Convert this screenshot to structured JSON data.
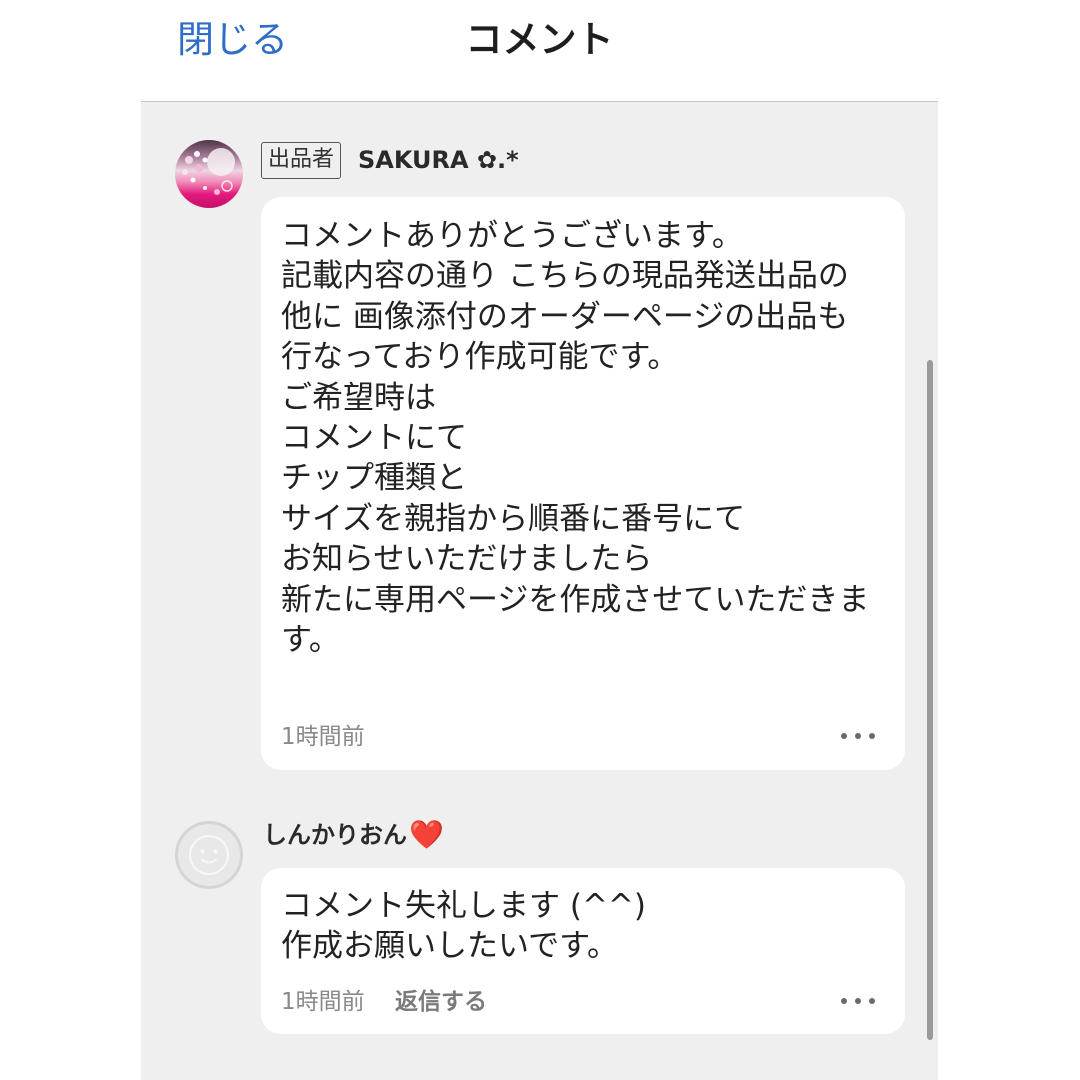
{
  "header": {
    "close_label": "閉じる",
    "title": "コメント"
  },
  "comments": [
    {
      "avatar_icon": "cherry-blossom-avatar-icon",
      "seller_badge": "出品者",
      "author": "SAKURA ✿.*",
      "body_lines": [
        "コメントありがとうございます。",
        "記載内容の通り こちらの現品発送出品の",
        "他に 画像添付のオーダーページの出品も",
        "行なっており作成可能です。",
        "ご希望時は",
        "コメントにて",
        "チップ種類と",
        "サイズを親指から順番に番号にて",
        "お知らせいただけましたら",
        "新たに専用ページを作成させていただきま",
        "す。"
      ],
      "time": "1時間前",
      "more_icon": "more-options-icon"
    },
    {
      "avatar_icon": "default-user-avatar-icon",
      "author": "しんかりおん",
      "author_emoji": "❤️",
      "body_lines": [
        "コメント失礼します (^^)",
        "作成お願いしたいです。"
      ],
      "time": "1時間前",
      "reply_label": "返信する",
      "more_icon": "more-options-icon"
    }
  ],
  "colors": {
    "accent": "#2f6dc9",
    "panel_background": "#efefef",
    "bubble_background": "#ffffff",
    "heart": "#e8232d",
    "muted_text": "#8a8a8a"
  }
}
